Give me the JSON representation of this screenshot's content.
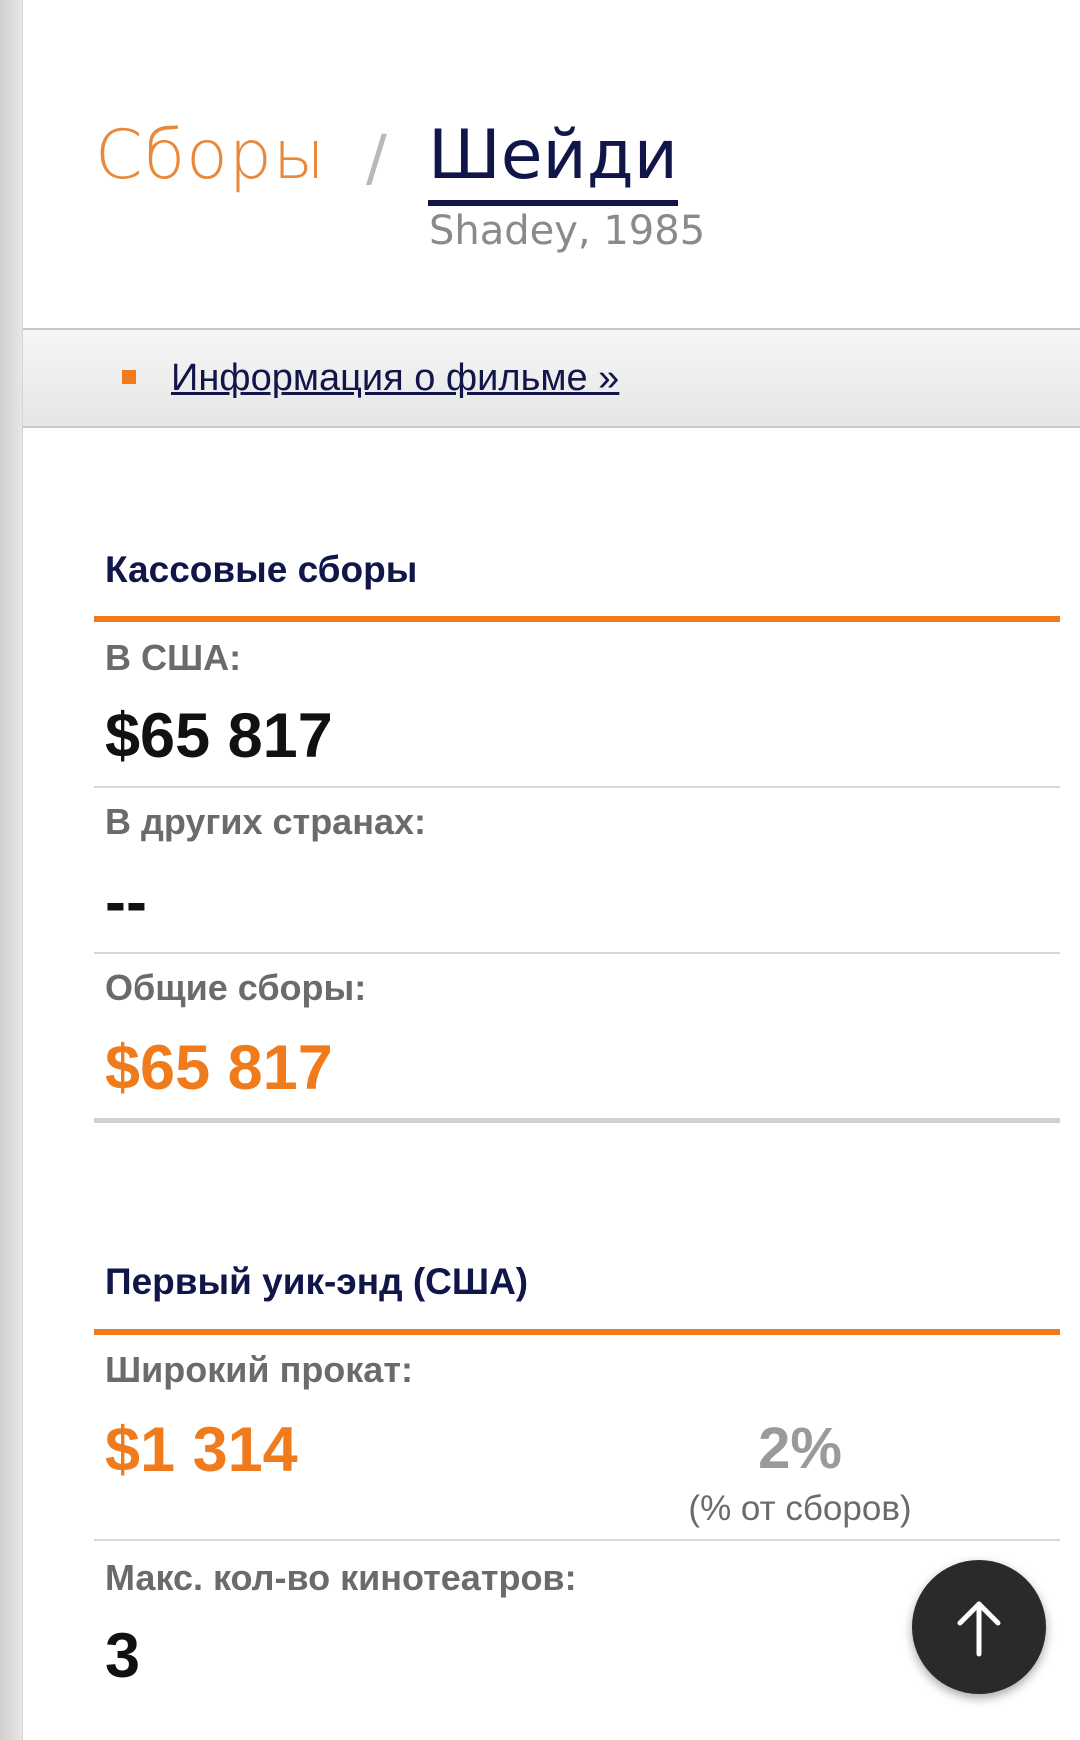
{
  "header": {
    "section": "Сборы",
    "separator": "/",
    "film_title": "Шейди",
    "film_subtitle": "Shadey, 1985"
  },
  "infobar": {
    "link_label": "Информация о фильме »"
  },
  "box_office": {
    "title": "Кассовые сборы",
    "rows": [
      {
        "label": "В США:",
        "value": "$65 817"
      },
      {
        "label": "В других странах:",
        "value": "--"
      },
      {
        "label": "Общие сборы:",
        "value": "$65 817"
      }
    ]
  },
  "opening_weekend": {
    "title": "Первый уик-энд (США)",
    "wide_release": {
      "label": "Широкий прокат:",
      "value": "$1 314",
      "percent": "2%",
      "percent_caption": "(% от сборов)"
    },
    "max_theaters": {
      "label": "Макс. кол-во кинотеатров:",
      "value": "3"
    }
  },
  "scroll_top_button": {
    "icon": "arrow-up-icon"
  },
  "colors": {
    "accent": "#f07b1c",
    "navy": "#10154a",
    "muted": "#6b6b6b"
  }
}
